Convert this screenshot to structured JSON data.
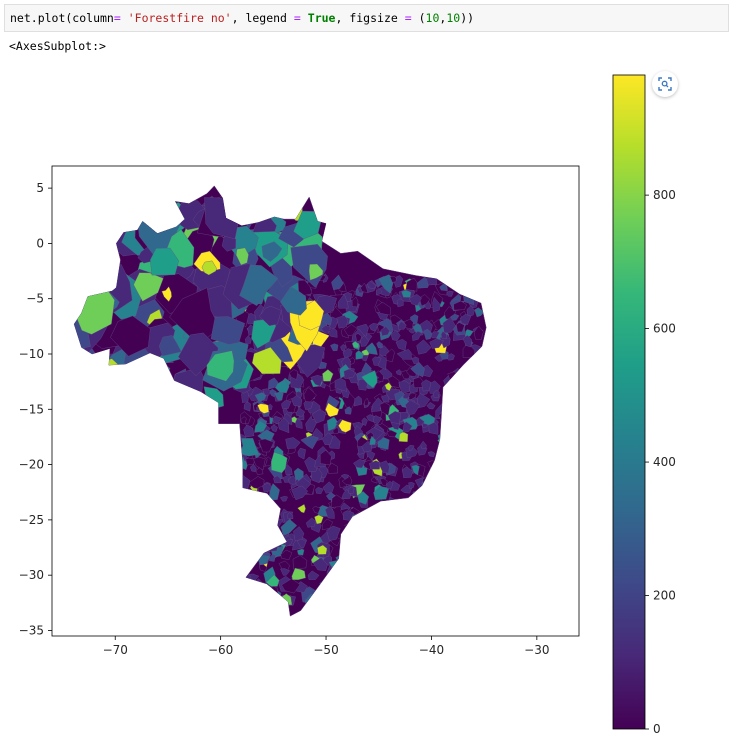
{
  "code_cell": {
    "tokens": [
      {
        "text": "net.plot(column",
        "cls": ""
      },
      {
        "text": "=",
        "cls": "tok-op"
      },
      {
        "text": " ",
        "cls": ""
      },
      {
        "text": "'Forestfire no'",
        "cls": "tok-str"
      },
      {
        "text": ", legend ",
        "cls": ""
      },
      {
        "text": "=",
        "cls": "tok-op"
      },
      {
        "text": " ",
        "cls": ""
      },
      {
        "text": "True",
        "cls": "tok-kw"
      },
      {
        "text": ", figsize ",
        "cls": ""
      },
      {
        "text": "=",
        "cls": "tok-op"
      },
      {
        "text": " (",
        "cls": ""
      },
      {
        "text": "10",
        "cls": "tok-num"
      },
      {
        "text": ",",
        "cls": ""
      },
      {
        "text": "10",
        "cls": "tok-num"
      },
      {
        "text": "))",
        "cls": ""
      }
    ]
  },
  "output_repr": "<AxesSubplot:>",
  "zoom_icon": "focus-zoom-icon",
  "colors": {
    "viridis": [
      "#440154",
      "#482878",
      "#3e4989",
      "#31688e",
      "#26828e",
      "#1f9e89",
      "#35b779",
      "#6ece58",
      "#b5de2b",
      "#fde725"
    ]
  },
  "chart_data": {
    "type": "choropleth-map",
    "xlim": [
      -76,
      -26
    ],
    "ylim": [
      -35.5,
      7
    ],
    "x_ticks": [
      -70,
      -60,
      -50,
      -40,
      -30
    ],
    "y_ticks": [
      5,
      0,
      -5,
      -10,
      -15,
      -20,
      -25,
      -30,
      -35
    ],
    "colorbar": {
      "min": 0,
      "max": 980,
      "ticks": [
        0,
        200,
        400,
        600,
        800
      ],
      "colormap": "viridis"
    }
  }
}
